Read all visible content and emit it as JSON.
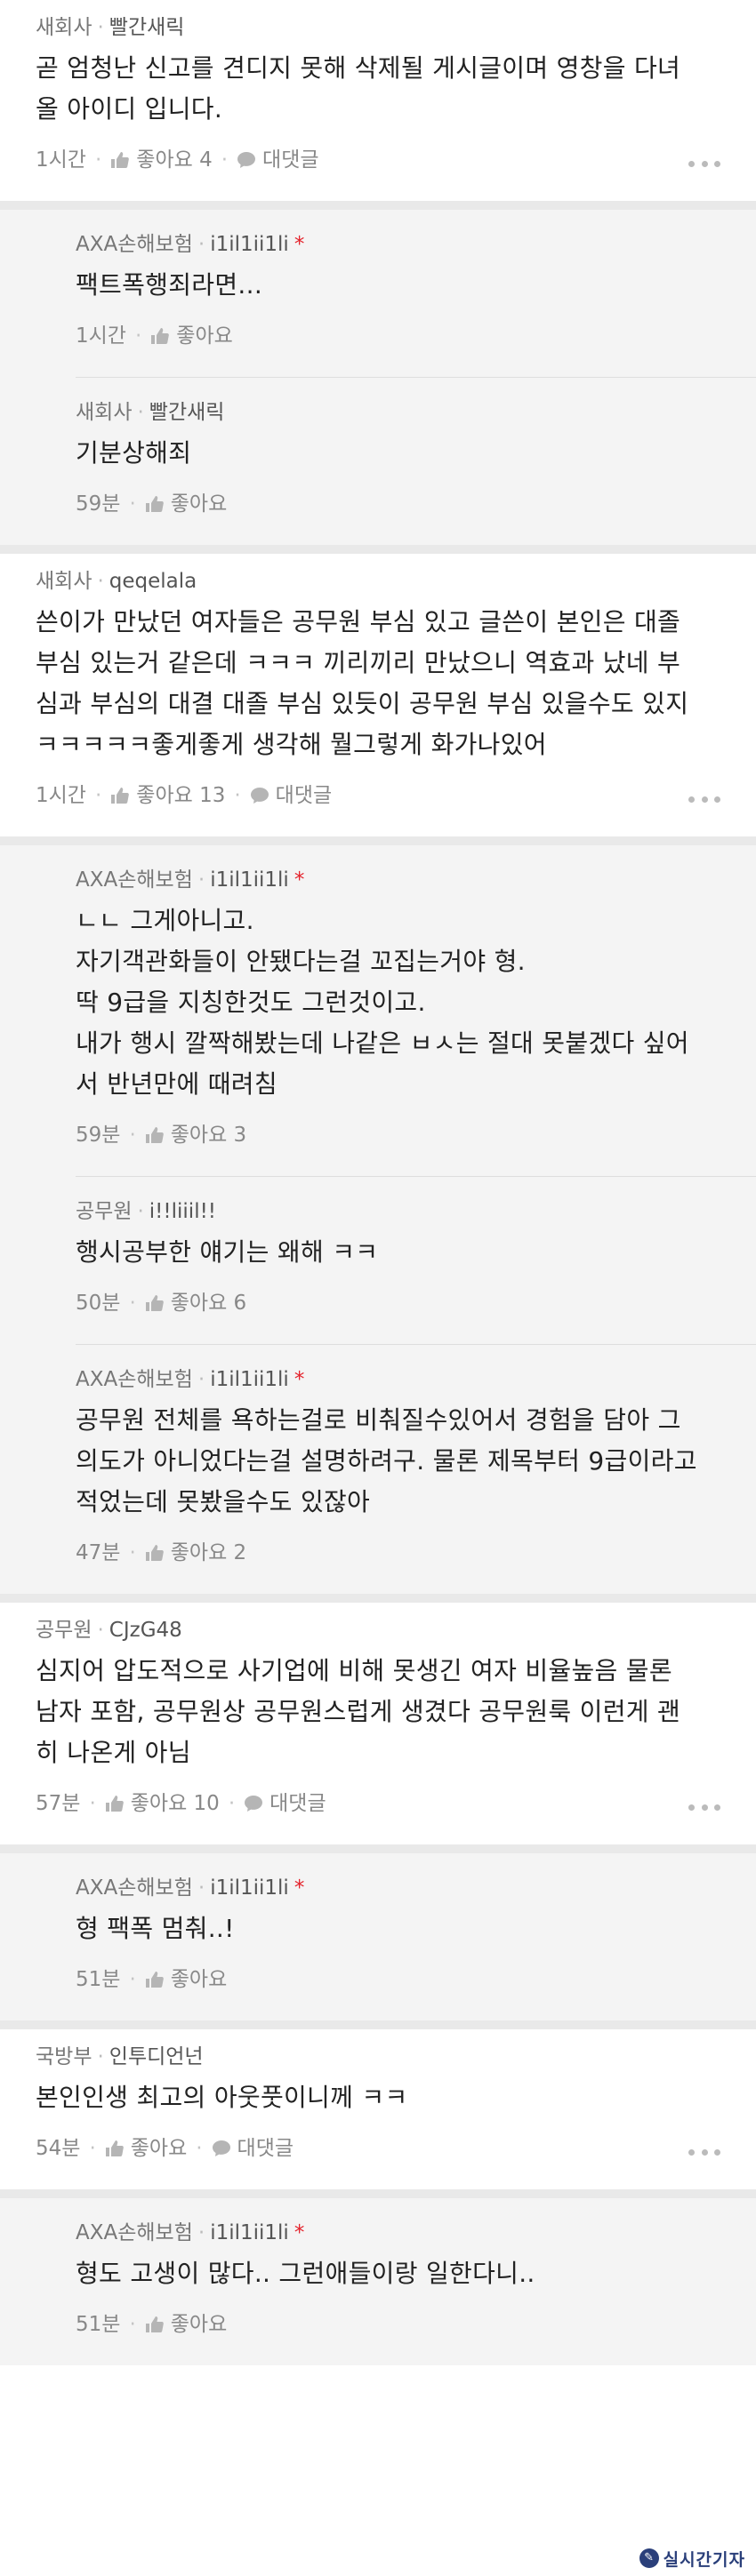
{
  "labels": {
    "like": "좋아요",
    "reply": "대댓글"
  },
  "comments": [
    {
      "type": "top",
      "org": "새회사",
      "nick": "빨간새릭",
      "mark": "",
      "body": "곧 엄청난 신고를 견디지 못해 삭제될 게시글이며 영창을 다녀\n올 아이디 입니다.",
      "time": "1시간",
      "likes": "4",
      "has_reply_link": true
    },
    {
      "type": "reply",
      "org": "AXA손해보험",
      "nick": "i1il1ii1li",
      "mark": "*",
      "body": "팩트폭행죄라면...",
      "time": "1시간",
      "likes": "",
      "has_reply_link": false
    },
    {
      "type": "reply",
      "org": "새회사",
      "nick": "빨간새릭",
      "mark": "",
      "body": "기분상해죄",
      "time": "59분",
      "likes": "",
      "has_reply_link": false
    },
    {
      "type": "top",
      "org": "새회사",
      "nick": "qeqelala",
      "mark": "",
      "body": "쓴이가 만났던 여자들은 공무원 부심 있고 글쓴이 본인은 대졸\n부심 있는거 같은데 ㅋㅋㅋ 끼리끼리 만났으니 역효과 났네 부\n심과 부심의 대결 대졸 부심 있듯이 공무원 부심 있을수도 있지\nㅋㅋㅋㅋㅋ좋게좋게 생각해 뭘그렇게 화가나있어",
      "time": "1시간",
      "likes": "13",
      "has_reply_link": true
    },
    {
      "type": "reply",
      "org": "AXA손해보험",
      "nick": "i1il1ii1li",
      "mark": "*",
      "body": "ㄴㄴ 그게아니고.\n자기객관화들이 안됐다는걸 꼬집는거야 형.\n딱 9급을 지칭한것도 그런것이고.\n내가 행시 깔짝해봤는데 나같은 ㅂㅅ는 절대 못붙겠다 싶어\n서 반년만에 때려침",
      "time": "59분",
      "likes": "3",
      "has_reply_link": false
    },
    {
      "type": "reply",
      "org": "공무원",
      "nick": "i!!liiil!!",
      "mark": "",
      "body": "행시공부한 얘기는 왜해 ㅋㅋ",
      "time": "50분",
      "likes": "6",
      "has_reply_link": false
    },
    {
      "type": "reply",
      "org": "AXA손해보험",
      "nick": "i1il1ii1li",
      "mark": "*",
      "body": "공무원 전체를 욕하는걸로 비춰질수있어서 경험을 담아 그\n의도가 아니었다는걸 설명하려구. 물론 제목부터 9급이라고\n적었는데 못봤을수도 있잖아",
      "time": "47분",
      "likes": "2",
      "has_reply_link": false
    },
    {
      "type": "top",
      "org": "공무원",
      "nick": "CJzG48",
      "mark": "",
      "body": "심지어 압도적으로 사기업에 비해 못생긴 여자 비율높음 물론\n남자 포함, 공무원상 공무원스럽게 생겼다 공무원룩 이런게 괜\n히 나온게 아님",
      "time": "57분",
      "likes": "10",
      "has_reply_link": true
    },
    {
      "type": "reply",
      "org": "AXA손해보험",
      "nick": "i1il1ii1li",
      "mark": "*",
      "body": "형 팩폭 멈춰..!",
      "time": "51분",
      "likes": "",
      "has_reply_link": false
    },
    {
      "type": "top",
      "org": "국방부",
      "nick": "인투디언넌",
      "mark": "",
      "body": "본인인생 최고의 아웃풋이니께 ㅋㅋ",
      "time": "54분",
      "likes": "",
      "has_reply_link": true
    },
    {
      "type": "reply",
      "org": "AXA손해보험",
      "nick": "i1il1ii1li",
      "mark": "*",
      "body": "형도 고생이 많다.. 그런애들이랑 일한다니..",
      "time": "51분",
      "likes": "",
      "has_reply_link": false
    }
  ],
  "watermark": {
    "text": "실시간기자"
  },
  "colors": {
    "mark": "#e4222b",
    "thick_divider": "#e9e9e9",
    "reply_bg": "#f4f4f4",
    "watermark": "#2a3f7a"
  }
}
